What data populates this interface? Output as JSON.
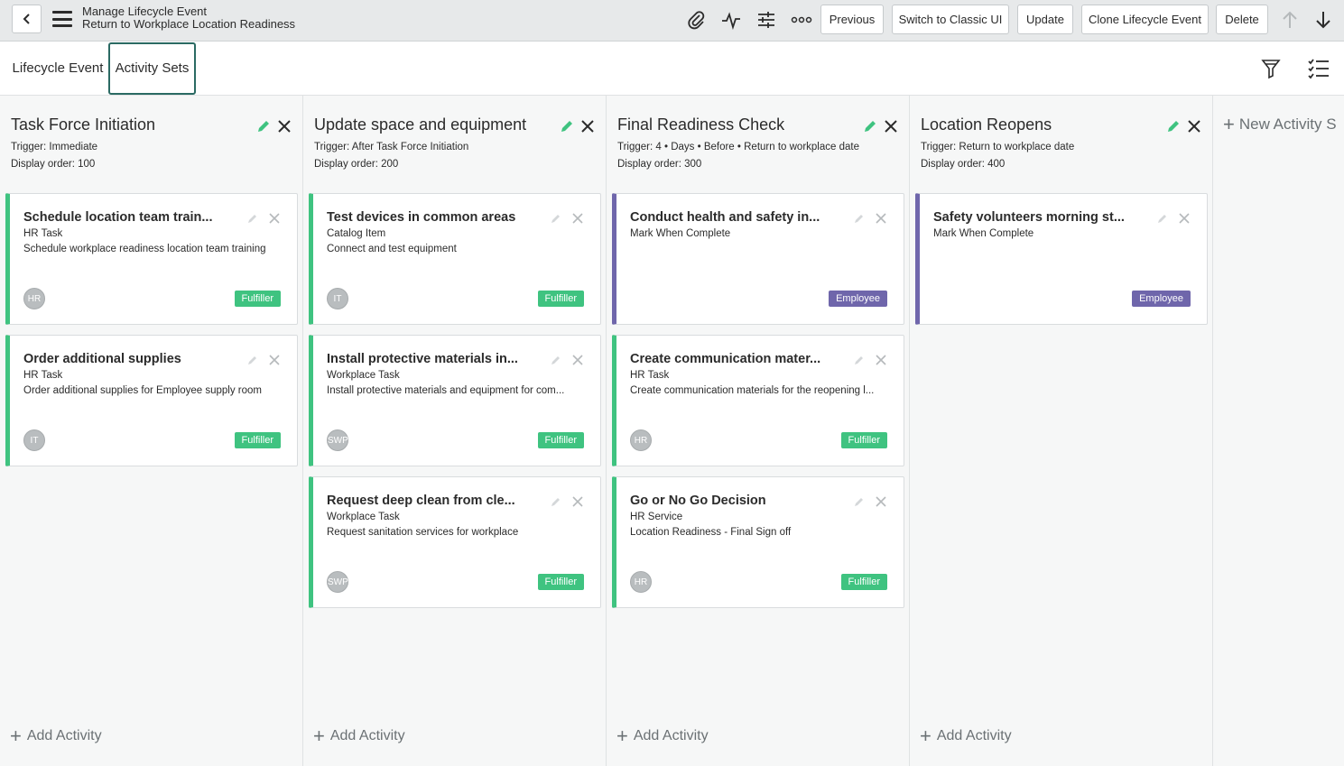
{
  "header": {
    "title": "Manage Lifecycle Event",
    "subtitle": "Return to Workplace Location Readiness",
    "buttons": {
      "previous": "Previous",
      "classic": "Switch to Classic UI",
      "update": "Update",
      "clone": "Clone Lifecycle Event",
      "delete": "Delete"
    },
    "icons": [
      "chevron-left-icon",
      "menu-icon",
      "paperclip-icon",
      "activity-icon",
      "sliders-icon",
      "more-icon",
      "arrow-up-icon",
      "arrow-down-icon"
    ]
  },
  "tabs": [
    {
      "label": "Lifecycle Event",
      "active": false
    },
    {
      "label": "Activity Sets",
      "active": true
    }
  ],
  "toolbar": {
    "icons": [
      "filter-icon",
      "checklist-icon"
    ]
  },
  "add_activity_label": "Add Activity",
  "new_activity_set_label": "New Activity S",
  "colors": {
    "green": "#3fc380",
    "purple": "#6f66ab",
    "tab_border": "#2b6a63"
  },
  "columns": [
    {
      "title": "Task Force Initiation",
      "trigger": "Trigger: Immediate",
      "order": "Display order: 100",
      "cards": [
        {
          "title": "Schedule location team train...",
          "type": "HR Task",
          "desc": "Schedule workplace readiness location team training",
          "avatar": "HR",
          "badge": "Fulfiller",
          "color": "green"
        },
        {
          "title": "Order additional supplies",
          "type": "HR Task",
          "desc": "Order additional supplies for Employee supply room",
          "avatar": "IT",
          "badge": "Fulfiller",
          "color": "green"
        }
      ]
    },
    {
      "title": "Update space and equipment",
      "trigger": "Trigger: After Task Force Initiation",
      "order": "Display order: 200",
      "cards": [
        {
          "title": "Test devices in common areas",
          "type": "Catalog Item",
          "desc": "Connect and test equipment",
          "avatar": "IT",
          "badge": "Fulfiller",
          "color": "green"
        },
        {
          "title": "Install protective materials in...",
          "type": "Workplace Task",
          "desc": "Install protective materials and equipment for com...",
          "avatar": "SWP",
          "badge": "Fulfiller",
          "color": "green"
        },
        {
          "title": "Request deep clean from cle...",
          "type": "Workplace Task",
          "desc": "Request sanitation services for workplace",
          "avatar": "SWP",
          "badge": "Fulfiller",
          "color": "green"
        }
      ]
    },
    {
      "title": "Final Readiness Check",
      "trigger": "Trigger: 4 • Days • Before • Return to workplace date",
      "order": "Display order: 300",
      "cards": [
        {
          "title": "Conduct health and safety in...",
          "type": "Mark When Complete",
          "desc": "",
          "avatar": "",
          "badge": "Employee",
          "color": "purple"
        },
        {
          "title": "Create communication mater...",
          "type": "HR Task",
          "desc": "Create communication materials for the reopening l...",
          "avatar": "HR",
          "badge": "Fulfiller",
          "color": "green"
        },
        {
          "title": "Go or No Go Decision",
          "type": "HR Service",
          "desc": "Location Readiness - Final Sign off",
          "avatar": "HR",
          "badge": "Fulfiller",
          "color": "green"
        }
      ]
    },
    {
      "title": "Location Reopens",
      "trigger": "Trigger: Return to workplace date",
      "order": "Display order: 400",
      "cards": [
        {
          "title": "Safety volunteers morning st...",
          "type": "Mark When Complete",
          "desc": "",
          "avatar": "",
          "badge": "Employee",
          "color": "purple"
        }
      ]
    }
  ]
}
